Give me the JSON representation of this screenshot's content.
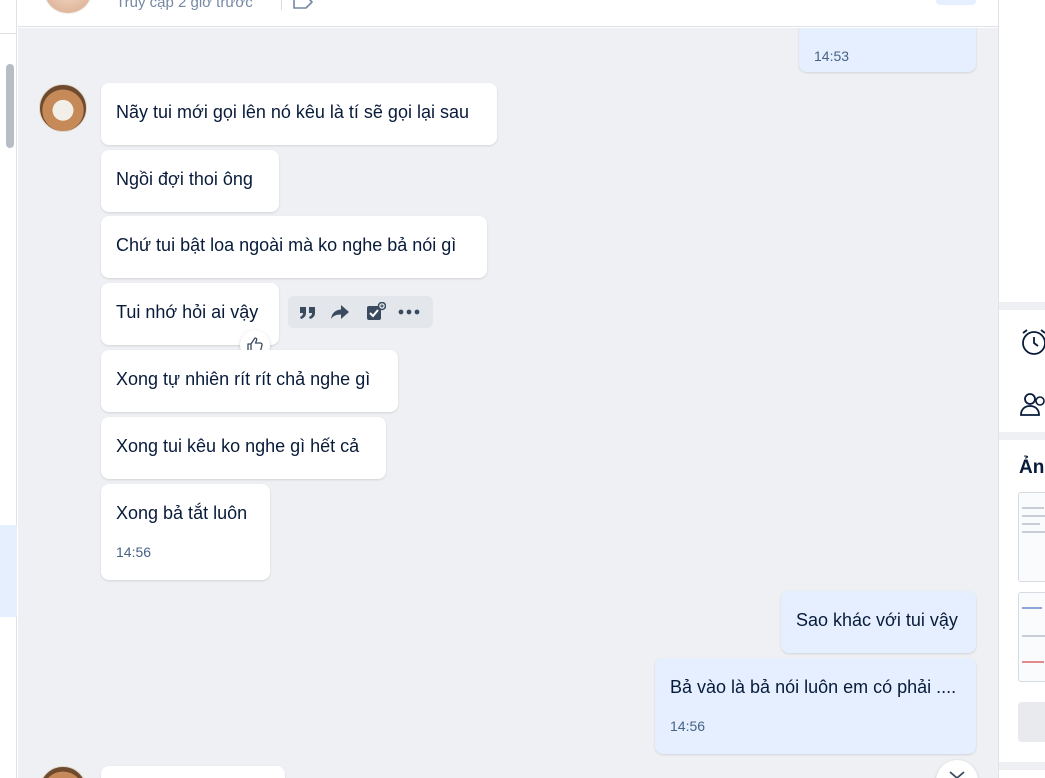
{
  "header": {
    "last_seen": "Truy cập 2 giờ trước"
  },
  "messages_top": {
    "time": "14:53"
  },
  "incoming": [
    {
      "text": "Nãy tui mới gọi lên nó kêu là tí sẽ gọi lại sau"
    },
    {
      "text": "Ngồi đợi thoi ông"
    },
    {
      "text": "Chứ tui bật loa ngoài mà ko nghe bả nói gì"
    },
    {
      "text": "Tui nhớ hỏi ai vậy"
    },
    {
      "text": "Xong tự nhiên rít rít chả nghe gì"
    },
    {
      "text": "Xong tui kêu ko nghe gì hết cả"
    },
    {
      "text": "Xong bả tắt luôn",
      "time": "14:56"
    }
  ],
  "outgoing": [
    {
      "text": "Sao khác với tui vậy"
    },
    {
      "text": "Bả vào là bả nói luôn em có phải ....",
      "time": "14:56"
    }
  ],
  "message_actions": [
    "quote-icon",
    "forward-icon",
    "add-todo-icon",
    "more-icon"
  ],
  "right_panel": {
    "media_title": "Ảnh",
    "icons": [
      "alarm-icon",
      "group-icon"
    ]
  },
  "colors": {
    "chat_bg": "#eef0f3",
    "incoming_bubble": "#ffffff",
    "outgoing_bubble": "#e5efff",
    "text": "#081b3a",
    "time_text": "#476285"
  }
}
